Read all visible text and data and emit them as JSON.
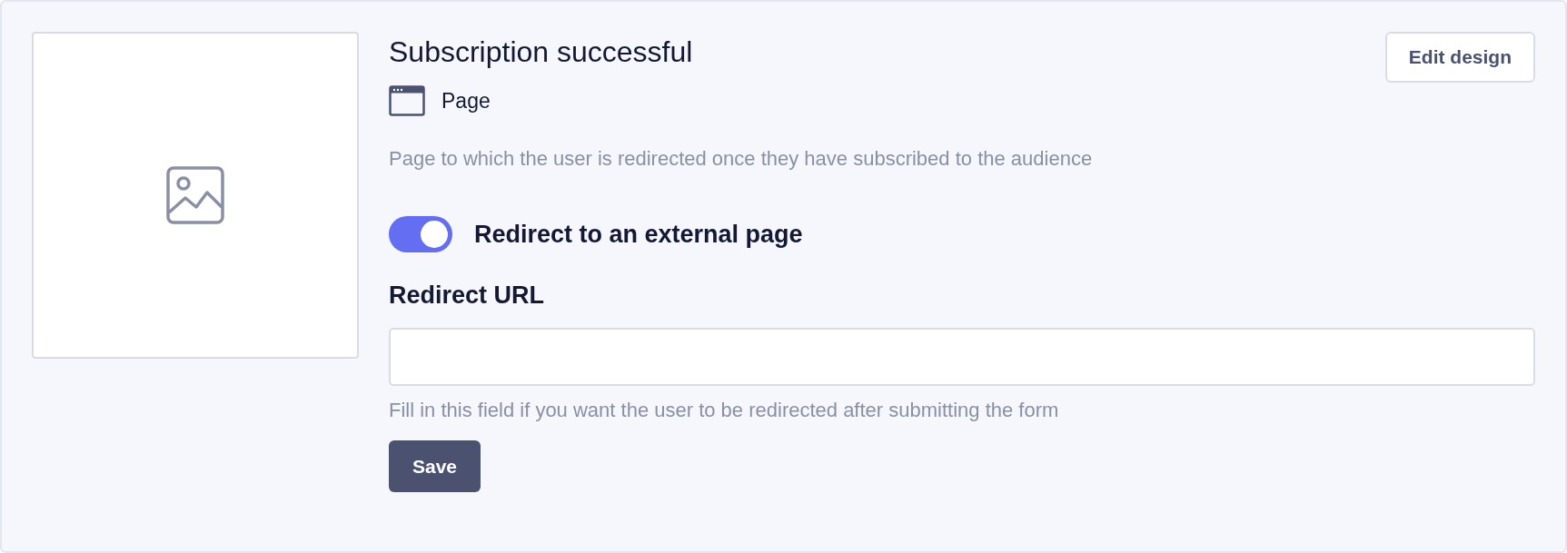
{
  "title": "Subscription successful",
  "edit_button": "Edit design",
  "type_label": "Page",
  "description": "Page to which the user is redirected once they have subscribed to the audience",
  "redirect_toggle": {
    "label": "Redirect to an external page",
    "on": true
  },
  "url_field": {
    "label": "Redirect URL",
    "hint": "Fill in this field if you want the user to be redirected after submitting the form"
  },
  "save_button": "Save"
}
